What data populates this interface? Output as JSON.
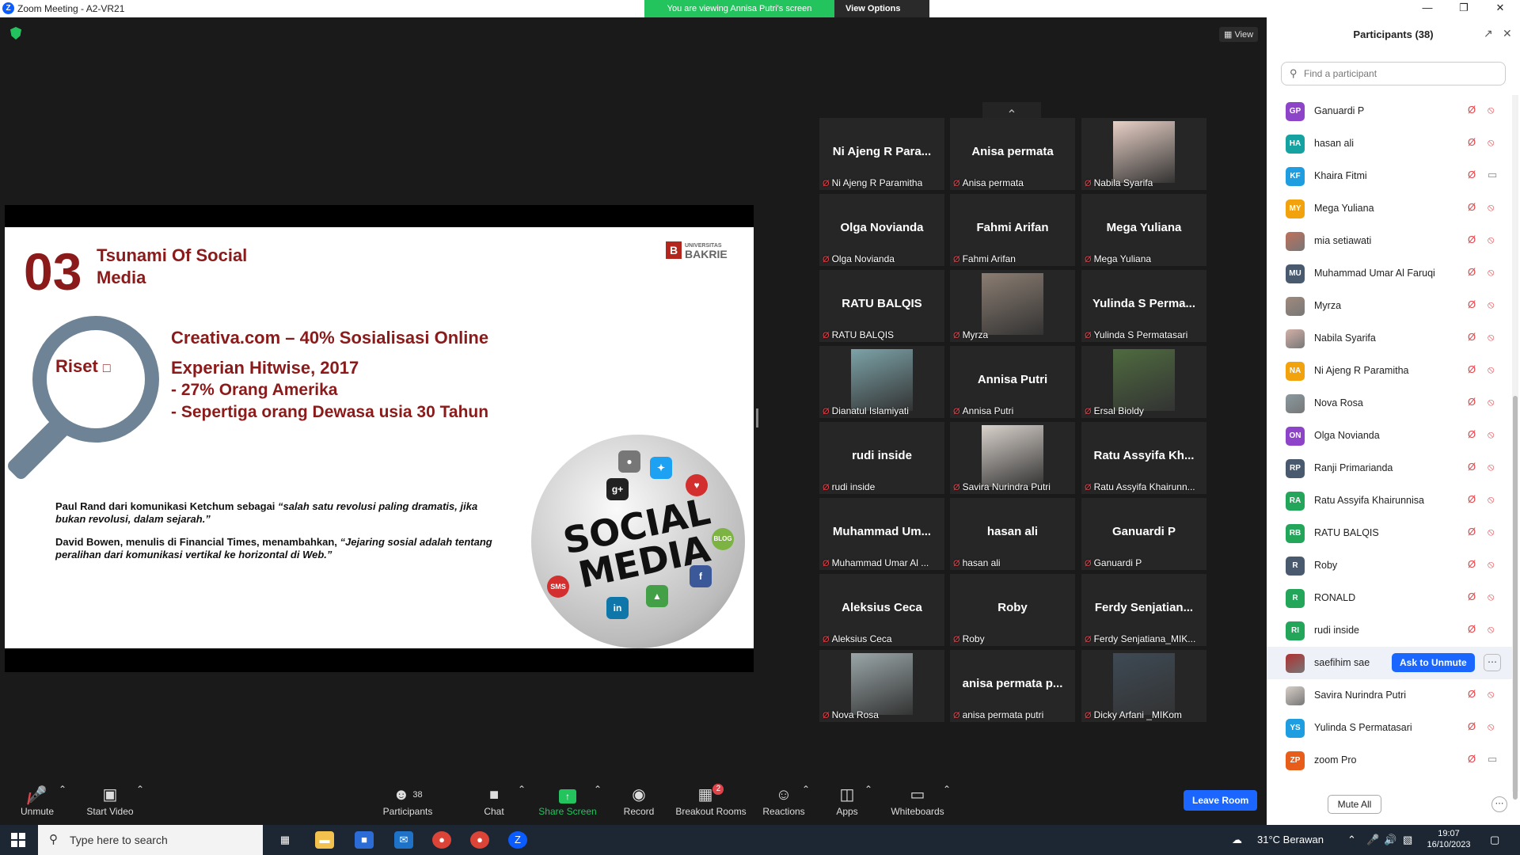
{
  "window": {
    "title": "Zoom Meeting - A2-VR21",
    "logo_letter": "Z"
  },
  "share_banner": {
    "text": "You are viewing Annisa Putri's screen",
    "view_options": "View Options"
  },
  "view_label": "View",
  "slide": {
    "number": "03",
    "title": "Tsunami Of Social Media",
    "logo_small": "UNIVERSITAS",
    "logo_big": "BAKRIE",
    "riset": "Riset",
    "line1": "Creativa.com – 40% Sosialisasi Online",
    "line2": "Experian Hitwise, 2017",
    "line3": "-  27% Orang Amerika",
    "line4": "-  Sepertiga orang Dewasa usia 30 Tahun",
    "quote1_a": "Paul Rand dari komunikasi Ketchum sebagai ",
    "quote1_b": "“salah satu revolusi paling dramatis, jika bukan revolusi, dalam sejarah.”",
    "quote2_a": "David Bowen, menulis di Financial Times, menambahkan, ",
    "quote2_b": "“Jejaring sosial adalah tentang peralihan dari komunikasi vertikal ke horizontal di Web.”",
    "globe_text": "SOCIAL MEDIA"
  },
  "gallery": [
    {
      "big": "Ni Ajeng R Para...",
      "label": "Ni Ajeng R Paramitha",
      "photo": false
    },
    {
      "big": "Anisa permata",
      "label": "Anisa permata",
      "photo": false
    },
    {
      "big": "",
      "label": "Nabila Syarifa",
      "photo": true,
      "color": "#e8d0c6"
    },
    {
      "big": "Olga Novianda",
      "label": "Olga Novianda",
      "photo": false
    },
    {
      "big": "Fahmi Arifan",
      "label": "Fahmi Arifan",
      "photo": false
    },
    {
      "big": "Mega Yuliana",
      "label": "Mega Yuliana",
      "photo": false
    },
    {
      "big": "RATU BALQIS",
      "label": "RATU BALQIS",
      "photo": false
    },
    {
      "big": "",
      "label": "Myrza",
      "photo": true,
      "color": "#8b7d72"
    },
    {
      "big": "Yulinda S Perma...",
      "label": "Yulinda S Permatasari",
      "photo": false
    },
    {
      "big": "",
      "label": "Dianatul Islamiyati",
      "photo": true,
      "color": "#7ca3a8"
    },
    {
      "big": "Annisa Putri",
      "label": "Annisa Putri",
      "photo": false
    },
    {
      "big": "",
      "label": "Ersal Bioldy",
      "photo": true,
      "color": "#4f6b3f"
    },
    {
      "big": "rudi inside",
      "label": "rudi inside",
      "photo": false
    },
    {
      "big": "",
      "label": "Savira Nurindra Putri",
      "photo": true,
      "color": "#d9d2cc"
    },
    {
      "big": "Ratu Assyifa Kh...",
      "label": "Ratu Assyifa Khairunn...",
      "photo": false
    },
    {
      "big": "Muhammad Um...",
      "label": "Muhammad Umar Al ...",
      "photo": false
    },
    {
      "big": "hasan ali",
      "label": "hasan ali",
      "photo": false
    },
    {
      "big": "Ganuardi P",
      "label": "Ganuardi P",
      "photo": false
    },
    {
      "big": "Aleksius Ceca",
      "label": "Aleksius Ceca",
      "photo": false
    },
    {
      "big": "Roby",
      "label": "Roby",
      "photo": false
    },
    {
      "big": "Ferdy Senjatian...",
      "label": "Ferdy Senjatiana_MIK...",
      "photo": false
    },
    {
      "big": "",
      "label": "Nova Rosa",
      "photo": true,
      "color": "#9aa6a8"
    },
    {
      "big": "anisa permata p...",
      "label": "anisa permata putri",
      "photo": false
    },
    {
      "big": "",
      "label": "Dicky Arfani _MIKom",
      "photo": true,
      "color": "#3e4a55"
    }
  ],
  "toolbar": {
    "unmute": "Unmute",
    "start_video": "Start Video",
    "participants": "Participants",
    "participants_count": "38",
    "chat": "Chat",
    "share_screen": "Share Screen",
    "record": "Record",
    "breakout": "Breakout Rooms",
    "breakout_badge": "2",
    "reactions": "Reactions",
    "apps": "Apps",
    "whiteboards": "Whiteboards",
    "leave": "Leave Room"
  },
  "panel": {
    "title": "Participants (38)",
    "search_placeholder": "Find a participant",
    "mute_all": "Mute All",
    "ask_unmute": "Ask to Unmute"
  },
  "participants": [
    {
      "initials": "GP",
      "name": "Ganuardi P",
      "color": "#8e44c9",
      "cam": "off"
    },
    {
      "initials": "HA",
      "name": "hasan ali",
      "color": "#17a2a2",
      "cam": "off"
    },
    {
      "initials": "KF",
      "name": "Khaira Fitmi",
      "color": "#1e9de0",
      "cam": "on"
    },
    {
      "initials": "MY",
      "name": "Mega Yuliana",
      "color": "#f2a20c",
      "cam": "off"
    },
    {
      "initials": "",
      "name": "mia setiawati",
      "color": "#c0705a",
      "cam": "off",
      "photo": true
    },
    {
      "initials": "MU",
      "name": "Muhammad Umar Al Faruqi",
      "color": "#4a5a6e",
      "cam": "off"
    },
    {
      "initials": "",
      "name": "Myrza",
      "color": "#a08a7c",
      "cam": "off",
      "photo": true
    },
    {
      "initials": "",
      "name": "Nabila Syarifa",
      "color": "#d4b0a8",
      "cam": "off",
      "photo": true
    },
    {
      "initials": "NA",
      "name": "Ni Ajeng R Paramitha",
      "color": "#f2a20c",
      "cam": "off"
    },
    {
      "initials": "",
      "name": "Nova Rosa",
      "color": "#8a9aa0",
      "cam": "off",
      "photo": true
    },
    {
      "initials": "ON",
      "name": "Olga Novianda",
      "color": "#8e44c9",
      "cam": "off"
    },
    {
      "initials": "RP",
      "name": "Ranji Primarianda",
      "color": "#4a5a6e",
      "cam": "off"
    },
    {
      "initials": "RA",
      "name": "Ratu Assyifa Khairunnisa",
      "color": "#23a55a",
      "cam": "off"
    },
    {
      "initials": "RB",
      "name": "RATU BALQIS",
      "color": "#23a55a",
      "cam": "off"
    },
    {
      "initials": "R",
      "name": "Roby",
      "color": "#4a5a6e",
      "cam": "off"
    },
    {
      "initials": "R",
      "name": "RONALD",
      "color": "#23a55a",
      "cam": "off"
    },
    {
      "initials": "RI",
      "name": "rudi inside",
      "color": "#23a55a",
      "cam": "off"
    },
    {
      "initials": "",
      "name": "saefihim sae",
      "color": "#b03030",
      "cam": "none",
      "photo": true,
      "highlight": true
    },
    {
      "initials": "",
      "name": "Savira Nurindra Putri",
      "color": "#d8cfc8",
      "cam": "off",
      "photo": true
    },
    {
      "initials": "YS",
      "name": "Yulinda S Permatasari",
      "color": "#1e9de0",
      "cam": "off"
    },
    {
      "initials": "ZP",
      "name": "zoom Pro",
      "color": "#e85d1a",
      "cam": "on"
    }
  ],
  "taskbar": {
    "search": "Type here to search",
    "weather": "31°C  Berawan",
    "time": "19:07",
    "date": "16/10/2023"
  }
}
